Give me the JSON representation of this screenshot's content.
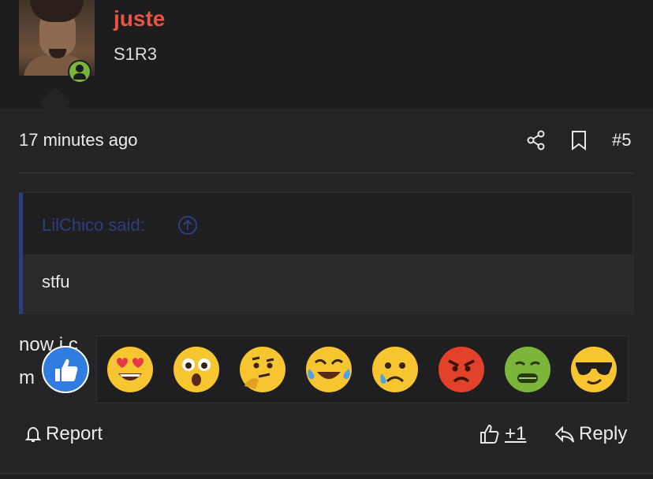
{
  "user": {
    "name": "juste",
    "title": "S1R3",
    "status_color": "#7ab539",
    "name_color": "#e85442"
  },
  "post": {
    "time": "17 minutes ago",
    "number": "#5",
    "share_icon": "share-icon",
    "bookmark_icon": "bookmark-icon"
  },
  "quote": {
    "author": "LilChico said:",
    "text": "stfu",
    "accent": "#2e3e7c"
  },
  "message": {
    "line1": "now i c",
    "line2": "m"
  },
  "reactions": [
    {
      "name": "like",
      "emoji": "👍"
    },
    {
      "name": "love",
      "emoji": "😍"
    },
    {
      "name": "wow",
      "emoji": "😲"
    },
    {
      "name": "thinking",
      "emoji": "🤔"
    },
    {
      "name": "haha",
      "emoji": "😂"
    },
    {
      "name": "sad",
      "emoji": "😢"
    },
    {
      "name": "angry",
      "emoji": "😡"
    },
    {
      "name": "sick",
      "emoji": "🤢"
    },
    {
      "name": "cool",
      "emoji": "😎"
    }
  ],
  "actions": {
    "report": "Report",
    "like_count": "+1",
    "reply": "Reply"
  }
}
